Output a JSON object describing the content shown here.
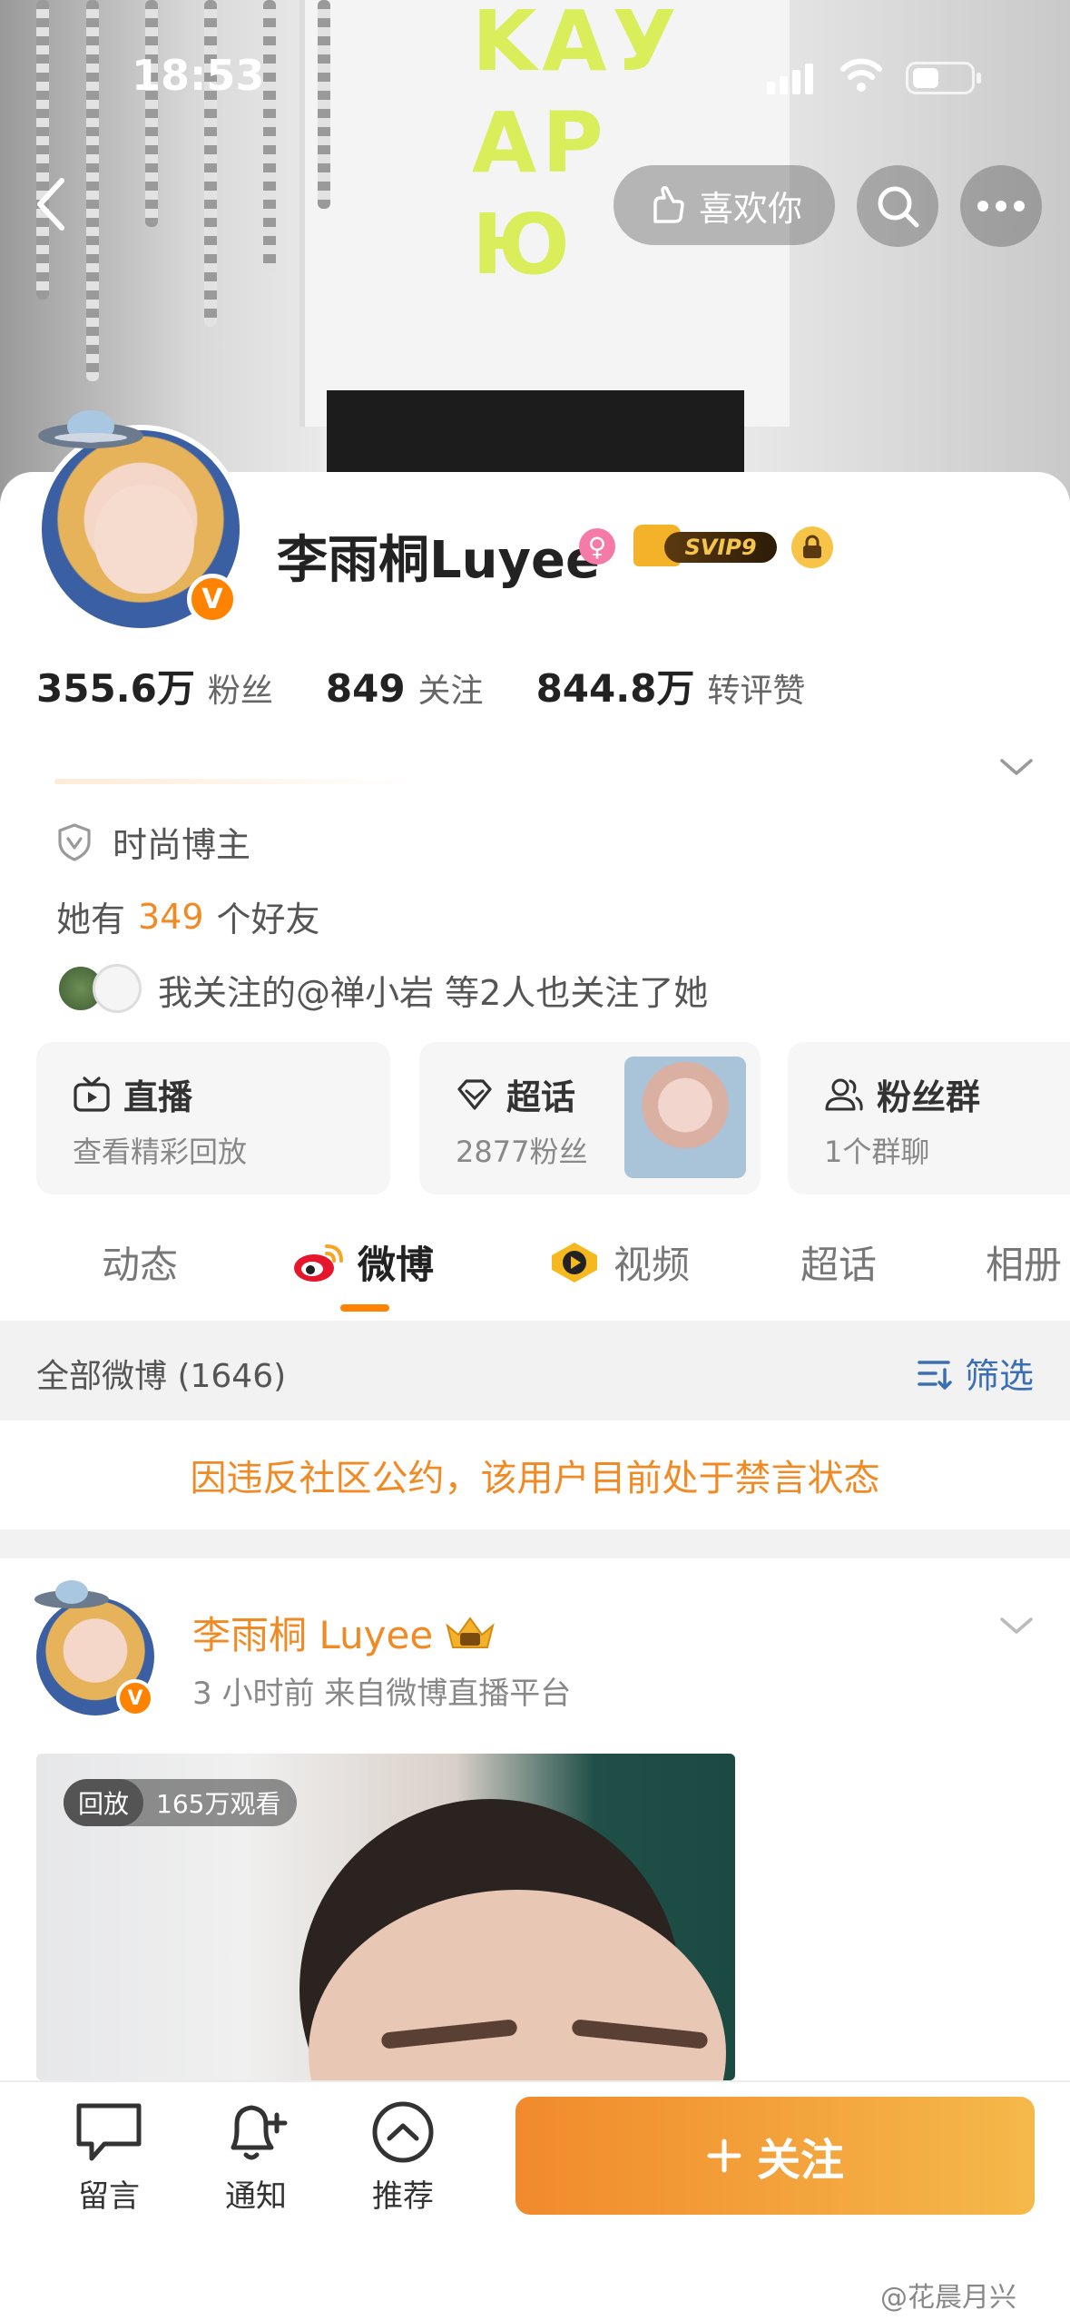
{
  "status_bar": {
    "time": "18:53"
  },
  "header": {
    "like_label": "喜欢你"
  },
  "profile": {
    "name": "李雨桐Luyee",
    "vip_badge": "SVIP9",
    "stats": [
      {
        "value": "355.6万",
        "label": "粉丝"
      },
      {
        "value": "849",
        "label": "关注"
      },
      {
        "value": "844.8万",
        "label": "转评赞"
      }
    ],
    "tag": "时尚博主",
    "friends_prefix": "她有",
    "friends_count": "349",
    "friends_suffix": "个好友",
    "mutual_text": "我关注的@禅小岩 等2人也关注了她"
  },
  "tiles": [
    {
      "title": "直播",
      "subtitle": "查看精彩回放"
    },
    {
      "title": "超话",
      "subtitle": "2877粉丝"
    },
    {
      "title": "粉丝群",
      "subtitle": "1个群聊"
    }
  ],
  "tabs": [
    {
      "label": "动态",
      "active": false
    },
    {
      "label": "微博",
      "active": true
    },
    {
      "label": "视频",
      "active": false
    },
    {
      "label": "超话",
      "active": false
    },
    {
      "label": "相册",
      "active": false
    }
  ],
  "feed_header": {
    "all_posts": "全部微博 (1646)",
    "filter": "筛选"
  },
  "notice": "因违反社区公约，该用户目前处于禁言状态",
  "post": {
    "author": "李雨桐 Luyee",
    "meta": "3 小时前   来自微博直播平台",
    "replay_label": "回放",
    "views": "165万观看"
  },
  "bottom_bar": {
    "message": "留言",
    "notify": "通知",
    "recommend": "推荐",
    "follow": "关注"
  },
  "watermark": "@花晨月兴",
  "colors": {
    "accent": "#ff8200",
    "notice": "#f08a24",
    "link": "#3a6fb5"
  }
}
